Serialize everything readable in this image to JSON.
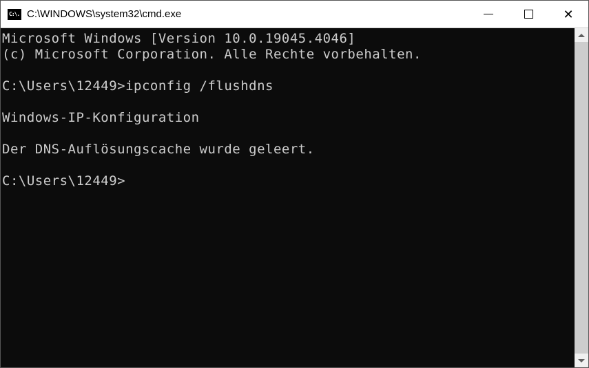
{
  "titlebar": {
    "icon_text": "C:\\.",
    "title": "C:\\WINDOWS\\system32\\cmd.exe"
  },
  "terminal": {
    "lines": {
      "l0": "Microsoft Windows [Version 10.0.19045.4046]",
      "l1": "(c) Microsoft Corporation. Alle Rechte vorbehalten.",
      "l2": "",
      "l3": "C:\\Users\\12449>ipconfig /flushdns",
      "l4": "",
      "l5": "Windows-IP-Konfiguration",
      "l6": "",
      "l7": "Der DNS-Auflösungscache wurde geleert.",
      "l8": "",
      "l9": "C:\\Users\\12449>"
    }
  }
}
